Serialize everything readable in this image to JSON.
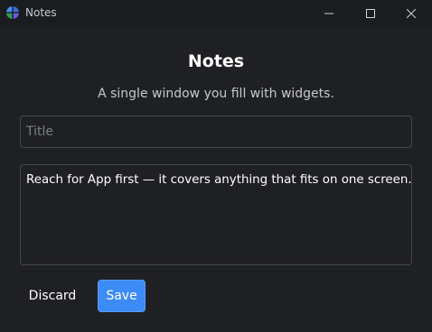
{
  "window": {
    "title": "Notes",
    "icon": "notes-app-icon",
    "controls": [
      "minimize-icon",
      "maximize-icon",
      "close-icon"
    ]
  },
  "main": {
    "heading": "Notes",
    "subtitle": "A single window you fill with widgets.",
    "title_field": {
      "value": "",
      "placeholder": "Title"
    },
    "body_field": {
      "value": "Reach for App first — it covers anything that fits on one screen."
    },
    "buttons": {
      "discard_label": "Discard",
      "save_label": "Save"
    }
  },
  "colors": {
    "background": "#1f2024",
    "accent": "#3d8bf7",
    "border": "#45474e"
  }
}
